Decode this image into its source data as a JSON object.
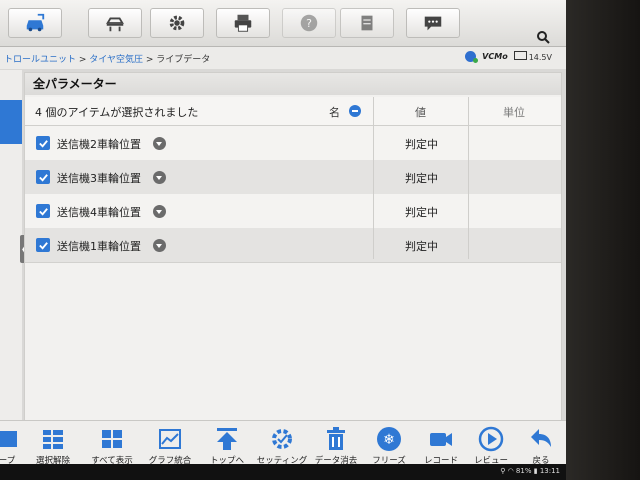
{
  "toolbar": {
    "buttons": [
      {
        "icon": "car-icon"
      },
      {
        "icon": "vehicle-lift-icon"
      },
      {
        "icon": "gear-icon"
      },
      {
        "icon": "printer-icon"
      },
      {
        "icon": "help-icon"
      },
      {
        "icon": "document-icon"
      },
      {
        "icon": "message-icon"
      }
    ],
    "search_icon": "search-icon"
  },
  "breadcrumb": {
    "part1": "トロールユニット",
    "sep": " > ",
    "part2": "タイヤ空気圧",
    "part3": "ライブデータ"
  },
  "status": {
    "vcm": "VCMo",
    "voltage": "14.5V"
  },
  "panel": {
    "title": "全パラメーター",
    "selected_count": "4 個のアイテムが選択されました",
    "col_name": "名",
    "col_value": "値",
    "col_unit": "単位"
  },
  "rows": [
    {
      "name": "送信機2車輪位置",
      "value": "判定中",
      "unit": ""
    },
    {
      "name": "送信機3車輪位置",
      "value": "判定中",
      "unit": ""
    },
    {
      "name": "送信機4車輪位置",
      "value": "判定中",
      "unit": ""
    },
    {
      "name": "送信機1車輪位置",
      "value": "判定中",
      "unit": ""
    }
  ],
  "bottom": {
    "items": [
      {
        "label": "ープ"
      },
      {
        "label": "選択解除"
      },
      {
        "label": "すべて表示"
      },
      {
        "label": "グラフ統合"
      },
      {
        "label": "トップへ"
      },
      {
        "label": "セッティング"
      },
      {
        "label": "データ消去"
      },
      {
        "label": "フリーズ"
      },
      {
        "label": "レコード"
      },
      {
        "label": "レビュー"
      },
      {
        "label": "戻る"
      }
    ]
  },
  "system": {
    "battery": "81%",
    "time": "13:11"
  },
  "colors": {
    "accent": "#2f78d4",
    "row_alt": "#e4e3e1"
  }
}
